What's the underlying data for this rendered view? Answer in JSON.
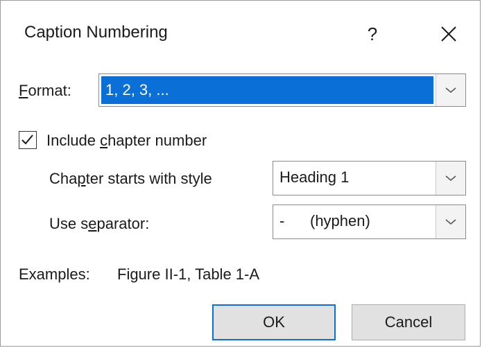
{
  "dialog": {
    "title": "Caption Numbering",
    "help_label": "?"
  },
  "format": {
    "label_mnemonic": "F",
    "label_rest": "ormat:",
    "value": "1, 2, 3, ..."
  },
  "include_chapter": {
    "checked": true,
    "label_pre": "Include ",
    "label_mnemonic": "c",
    "label_post": "hapter number"
  },
  "chapter_style": {
    "label_pre": "Cha",
    "label_mnemonic": "p",
    "label_post": "ter starts with style",
    "value": "Heading 1"
  },
  "separator": {
    "label_pre": "Use s",
    "label_mnemonic": "e",
    "label_post": "parator:",
    "value": "-      (hyphen)"
  },
  "examples": {
    "label": "Examples:",
    "text": "Figure II-1, Table 1-A"
  },
  "buttons": {
    "ok": "OK",
    "cancel": "Cancel"
  },
  "colors": {
    "accent": "#0a6fd7",
    "button_face": "#e1e1e1"
  }
}
